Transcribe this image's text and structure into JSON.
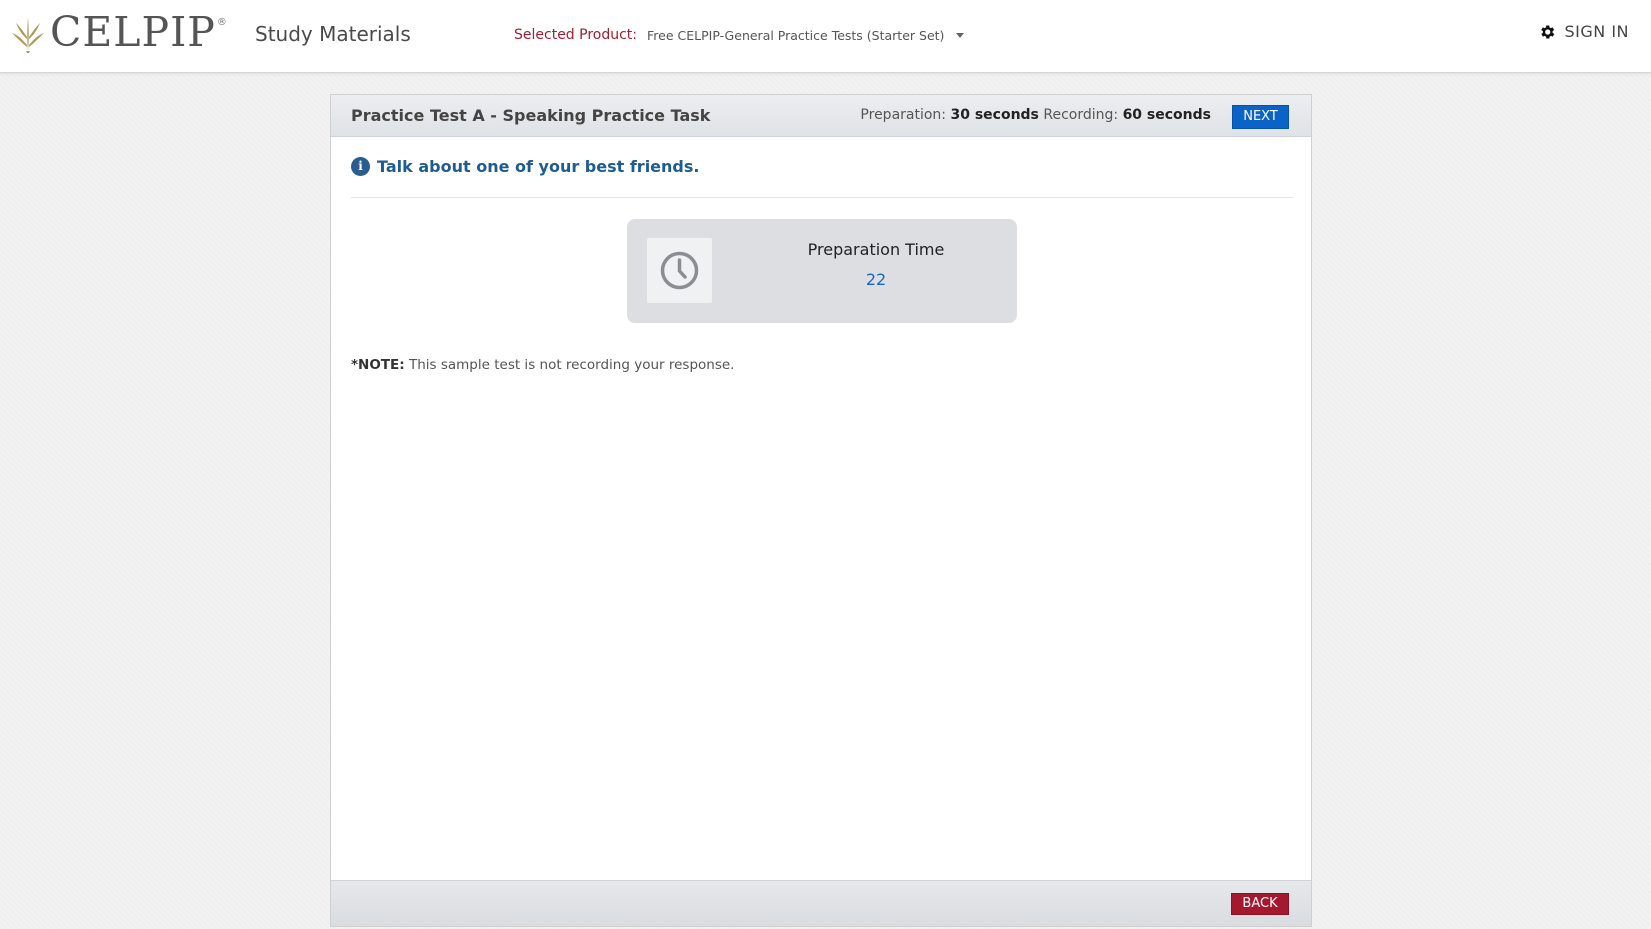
{
  "header": {
    "logo_text": "CELPIP",
    "logo_reg": "®",
    "section_title": "Study Materials",
    "product_label": "Selected Product:",
    "product_value": "Free CELPIP-General Practice Tests (Starter Set)",
    "signin_label": "SIGN IN"
  },
  "panel": {
    "title": "Practice Test A - Speaking Practice Task",
    "preparation_label": "Preparation:",
    "preparation_value": "30 seconds",
    "recording_label": "Recording:",
    "recording_value": "60 seconds",
    "next_label": "NEXT",
    "instruction": "Talk about one of your best friends.",
    "prep_box": {
      "title": "Preparation Time",
      "countdown": "22"
    },
    "note_label": "*NOTE:",
    "note_text": "This sample test is not recording your response.",
    "back_label": "BACK"
  },
  "colors": {
    "accent_blue": "#0b63c7",
    "brand_red": "#a5192f",
    "instruction_blue": "#1f5c93"
  },
  "icons": [
    "celpip-leaf-logo-icon",
    "chevron-down-icon",
    "gear-icon",
    "info-icon",
    "clock-icon"
  ]
}
